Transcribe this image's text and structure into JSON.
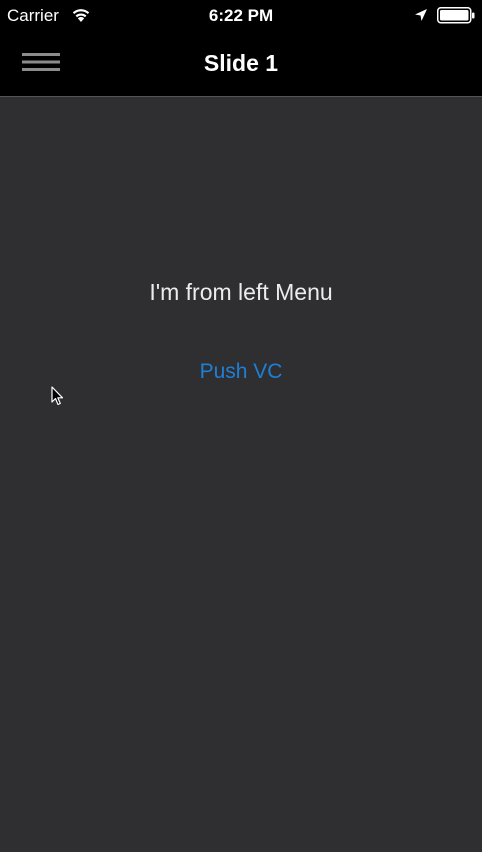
{
  "status_bar": {
    "carrier": "Carrier",
    "time": "6:22 PM",
    "icons": [
      "wifi-icon",
      "location-arrow-icon",
      "battery-icon"
    ]
  },
  "nav_bar": {
    "title": "Slide 1",
    "menu_icon": "hamburger-menu-icon"
  },
  "content": {
    "message": "I'm from left Menu",
    "push_button_label": "Push VC"
  },
  "colors": {
    "status_bar_bg": "#000000",
    "nav_bar_bg": "#000000",
    "content_bg": "#2f2f31",
    "text": "#ececec",
    "link": "#1e7fd6"
  }
}
